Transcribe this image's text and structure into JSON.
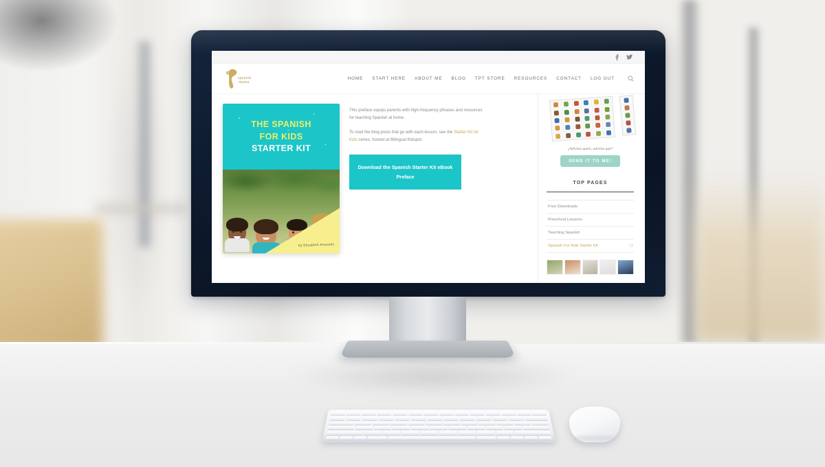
{
  "scene": {
    "device": "imac-desktop-computer",
    "peripherals": [
      "magic-keyboard",
      "magic-mouse"
    ]
  },
  "site": {
    "social_bar": {
      "icons": [
        {
          "name": "facebook-icon",
          "label": "Facebook"
        },
        {
          "name": "twitter-icon",
          "label": "Twitter"
        }
      ]
    },
    "logo": {
      "name": "spanish-mama-logo",
      "alt": "Spanish Mama"
    },
    "nav": {
      "items": [
        {
          "label": "HOME"
        },
        {
          "label": "START HERE"
        },
        {
          "label": "ABOUT ME"
        },
        {
          "label": "BLOG"
        },
        {
          "label": "TPT STORE"
        },
        {
          "label": "RESOURCES"
        },
        {
          "label": "CONTACT"
        },
        {
          "label": "LOG OUT"
        }
      ],
      "search_icon": "search-icon"
    },
    "book": {
      "title_line1": "THE SPANISH",
      "title_line2": "FOR KIDS",
      "title_line3": "STARTER KIT",
      "author": "by Elisabeth Alvarado",
      "cover_color": "#1cc5c8",
      "accent_color": "#e9f06a",
      "corner_color": "#f7ef8e"
    },
    "content": {
      "paragraph_1": "This preface equips parents with high-frequency phrases and resources for teaching Spanish at home.",
      "paragraph_2_pre": "To read the blog posts that go with each lesson, see the ",
      "paragraph_2_link": "Starter Kit for Kids",
      "paragraph_2_post": " series, hosted at Bilingual Kidspot.",
      "download_button": "Download the Spanish Starter Kit eBook Preface",
      "button_color": "#1cc5c8",
      "link_color": "#c8a657"
    },
    "sidebar": {
      "optin": {
        "image_name": "spanish-flashcards-preview",
        "tagline": "¿Adivina quién, adivina qué?",
        "button_label": "SEND IT TO ME!",
        "button_color": "#9ed4c6"
      },
      "top_pages": {
        "title": "TOP PAGES",
        "items": [
          {
            "label": "",
            "active": false,
            "mark": ""
          },
          {
            "label": "Free Downloads",
            "active": false,
            "mark": ""
          },
          {
            "label": "Preschool Lessons",
            "active": false,
            "mark": ""
          },
          {
            "label": "Teaching Spanish",
            "active": false,
            "mark": ""
          },
          {
            "label": "Spanish For Kids Starter Kit",
            "active": true,
            "mark": "❑"
          }
        ]
      },
      "thumb_strip_name": "recent-posts-thumbnails"
    }
  }
}
